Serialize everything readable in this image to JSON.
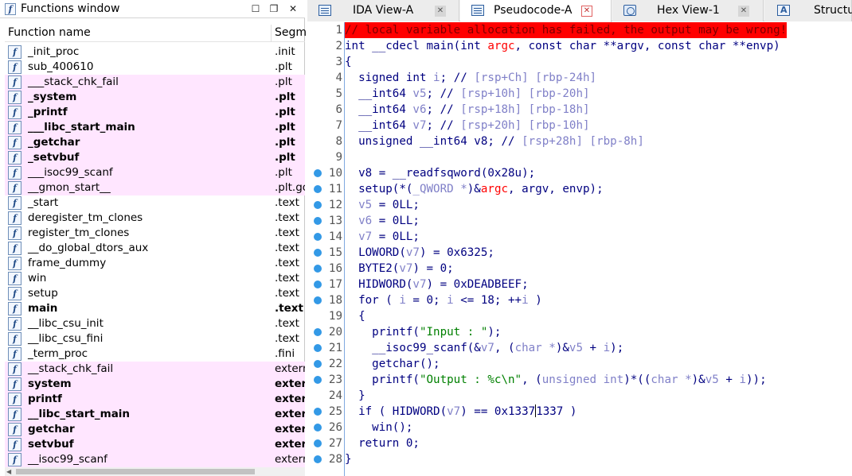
{
  "functions_window": {
    "title": "Functions window",
    "col_function_name": "Function name",
    "col_segment": "Segm",
    "rows": [
      {
        "name": "_init_proc",
        "segment": ".init",
        "highlight": false,
        "bold": false
      },
      {
        "name": "sub_400610",
        "segment": ".plt",
        "highlight": false,
        "bold": false
      },
      {
        "name": "___stack_chk_fail",
        "segment": ".plt",
        "highlight": true,
        "bold": false
      },
      {
        "name": "_system",
        "segment": ".plt",
        "highlight": true,
        "bold": true
      },
      {
        "name": "_printf",
        "segment": ".plt",
        "highlight": true,
        "bold": true
      },
      {
        "name": "___libc_start_main",
        "segment": ".plt",
        "highlight": true,
        "bold": true
      },
      {
        "name": "_getchar",
        "segment": ".plt",
        "highlight": true,
        "bold": true
      },
      {
        "name": "_setvbuf",
        "segment": ".plt",
        "highlight": true,
        "bold": true
      },
      {
        "name": "___isoc99_scanf",
        "segment": ".plt",
        "highlight": true,
        "bold": false
      },
      {
        "name": "__gmon_start__",
        "segment": ".plt.go",
        "highlight": true,
        "bold": false
      },
      {
        "name": "_start",
        "segment": ".text",
        "highlight": false,
        "bold": false
      },
      {
        "name": "deregister_tm_clones",
        "segment": ".text",
        "highlight": false,
        "bold": false
      },
      {
        "name": "register_tm_clones",
        "segment": ".text",
        "highlight": false,
        "bold": false
      },
      {
        "name": "__do_global_dtors_aux",
        "segment": ".text",
        "highlight": false,
        "bold": false
      },
      {
        "name": "frame_dummy",
        "segment": ".text",
        "highlight": false,
        "bold": false
      },
      {
        "name": "win",
        "segment": ".text",
        "highlight": false,
        "bold": false
      },
      {
        "name": "setup",
        "segment": ".text",
        "highlight": false,
        "bold": false
      },
      {
        "name": "main",
        "segment": ".text",
        "highlight": false,
        "bold": true
      },
      {
        "name": "__libc_csu_init",
        "segment": ".text",
        "highlight": false,
        "bold": false
      },
      {
        "name": "__libc_csu_fini",
        "segment": ".text",
        "highlight": false,
        "bold": false
      },
      {
        "name": "_term_proc",
        "segment": ".fini",
        "highlight": false,
        "bold": false
      },
      {
        "name": "__stack_chk_fail",
        "segment": "extern",
        "highlight": true,
        "bold": false
      },
      {
        "name": "system",
        "segment": "extern",
        "highlight": true,
        "bold": true
      },
      {
        "name": "printf",
        "segment": "extern",
        "highlight": true,
        "bold": true
      },
      {
        "name": "__libc_start_main",
        "segment": "extern",
        "highlight": true,
        "bold": true
      },
      {
        "name": "getchar",
        "segment": "extern",
        "highlight": true,
        "bold": true
      },
      {
        "name": "setvbuf",
        "segment": "extern",
        "highlight": true,
        "bold": true
      },
      {
        "name": "__isoc99_scanf",
        "segment": "extern",
        "highlight": true,
        "bold": false
      }
    ]
  },
  "tabs": [
    {
      "label": "IDA View-A",
      "icon": "ida-view-icon",
      "active": false
    },
    {
      "label": "Pseudocode-A",
      "icon": "pseudocode-icon",
      "active": true
    },
    {
      "label": "Hex View-1",
      "icon": "hex-view-icon",
      "active": false
    },
    {
      "label": "Structur",
      "icon": "structures-icon",
      "active": false
    }
  ],
  "tab_close_glyph": "✕",
  "colors": {
    "error_bg": "#ff0000",
    "highlight_row": "#ffe6ff",
    "breakpoint_dot": "#3399e6",
    "string": "#008000",
    "keyword": "#000080"
  },
  "pseudocode": {
    "lines": [
      {
        "n": "1",
        "dot": false,
        "text": "// local variable allocation has failed, the output may be wrong!"
      },
      {
        "n": "2",
        "dot": false,
        "text": "int __cdecl main(int argc, const char **argv, const char **envp)"
      },
      {
        "n": "3",
        "dot": false,
        "text": "{"
      },
      {
        "n": "4",
        "dot": false,
        "text": "  signed int i; // [rsp+Ch] [rbp-24h]"
      },
      {
        "n": "5",
        "dot": false,
        "text": "  __int64 v5; // [rsp+10h] [rbp-20h]"
      },
      {
        "n": "6",
        "dot": false,
        "text": "  __int64 v6; // [rsp+18h] [rbp-18h]"
      },
      {
        "n": "7",
        "dot": false,
        "text": "  __int64 v7; // [rsp+20h] [rbp-10h]"
      },
      {
        "n": "8",
        "dot": false,
        "text": "  unsigned __int64 v8; // [rsp+28h] [rbp-8h]"
      },
      {
        "n": "9",
        "dot": false,
        "text": ""
      },
      {
        "n": "10",
        "dot": true,
        "text": "  v8 = __readfsqword(0x28u);"
      },
      {
        "n": "11",
        "dot": true,
        "text": "  setup(*(_QWORD *)&argc, argv, envp);"
      },
      {
        "n": "12",
        "dot": true,
        "text": "  v5 = 0LL;"
      },
      {
        "n": "13",
        "dot": true,
        "text": "  v6 = 0LL;"
      },
      {
        "n": "14",
        "dot": true,
        "text": "  v7 = 0LL;"
      },
      {
        "n": "15",
        "dot": true,
        "text": "  LOWORD(v7) = 0x6325;"
      },
      {
        "n": "16",
        "dot": true,
        "text": "  BYTE2(v7) = 0;"
      },
      {
        "n": "17",
        "dot": true,
        "text": "  HIDWORD(v7) = 0xDEADBEEF;"
      },
      {
        "n": "18",
        "dot": true,
        "text": "  for ( i = 0; i <= 18; ++i )"
      },
      {
        "n": "19",
        "dot": false,
        "text": "  {"
      },
      {
        "n": "20",
        "dot": true,
        "text": "    printf(\"Input : \");"
      },
      {
        "n": "21",
        "dot": true,
        "text": "    __isoc99_scanf(&v7, (char *)&v5 + i);"
      },
      {
        "n": "22",
        "dot": true,
        "text": "    getchar();"
      },
      {
        "n": "23",
        "dot": true,
        "text": "    printf(\"Output : %c\\n\", (unsigned int)*((char *)&v5 + i));"
      },
      {
        "n": "24",
        "dot": false,
        "text": "  }"
      },
      {
        "n": "25",
        "dot": true,
        "text": "  if ( HIDWORD(v7) == 0x13371337 )"
      },
      {
        "n": "26",
        "dot": true,
        "text": "    win();"
      },
      {
        "n": "27",
        "dot": true,
        "text": "  return 0;"
      },
      {
        "n": "28",
        "dot": true,
        "text": "}"
      }
    ]
  }
}
